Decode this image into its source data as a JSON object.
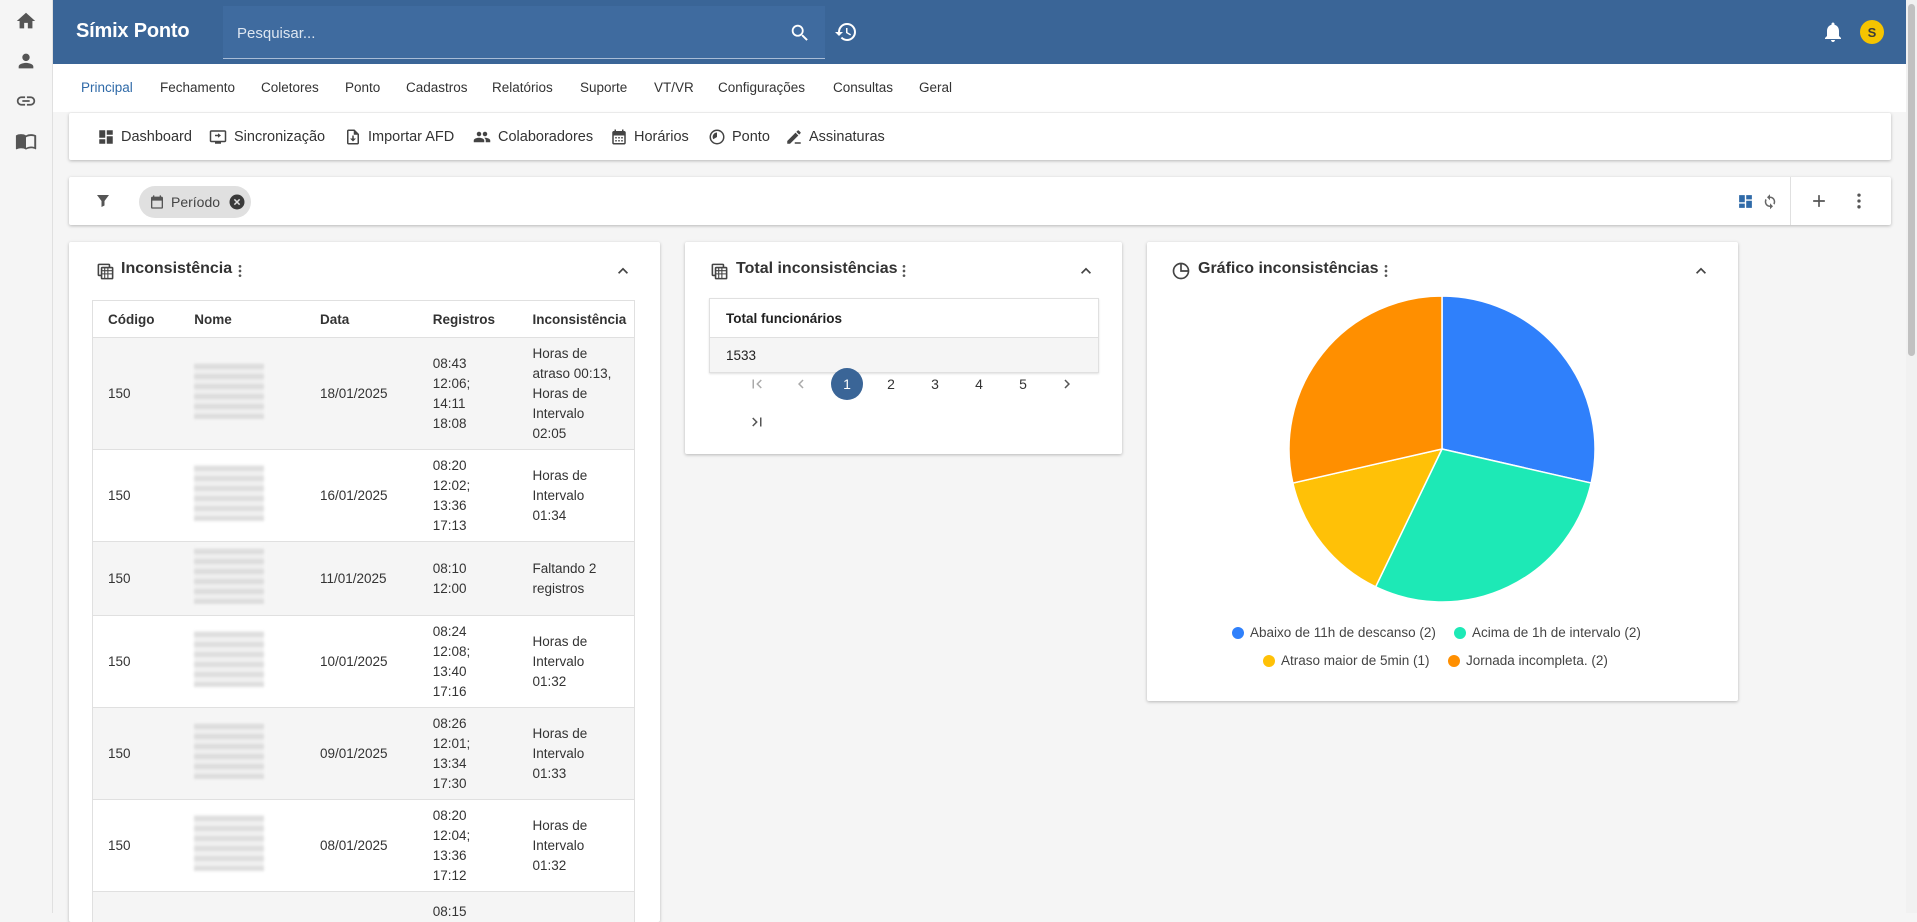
{
  "app": {
    "title": "Símix Ponto",
    "avatar_letter": "S"
  },
  "search": {
    "placeholder": "Pesquisar..."
  },
  "main_menu": [
    "Principal",
    "Fechamento",
    "Coletores",
    "Ponto",
    "Cadastros",
    "Relatórios",
    "Suporte",
    "VT/VR",
    "Configurações",
    "Consultas",
    "Geral"
  ],
  "sub_menu": [
    "Dashboard",
    "Sincronização",
    "Importar AFD",
    "Colaboradores",
    "Horários",
    "Ponto",
    "Assinaturas"
  ],
  "filter": {
    "chip_label": "Período"
  },
  "inconsistencia": {
    "title": "Inconsistência",
    "columns": [
      "Código",
      "Nome",
      "Data",
      "Registros",
      "Inconsistência"
    ],
    "rows": [
      {
        "codigo": "150",
        "data": "18/01/2025",
        "registros": [
          "08:43",
          "12:06;",
          "14:11",
          "18:08"
        ],
        "inconsistencia": [
          "Horas de",
          "atraso 00:13,",
          "Horas de",
          "Intervalo",
          "02:05"
        ]
      },
      {
        "codigo": "150",
        "data": "16/01/2025",
        "registros": [
          "08:20",
          "12:02;",
          "13:36",
          "17:13"
        ],
        "inconsistencia": [
          "Horas de",
          "Intervalo",
          "01:34"
        ]
      },
      {
        "codigo": "150",
        "data": "11/01/2025",
        "registros": [
          "08:10",
          "12:00"
        ],
        "inconsistencia": [
          "Faltando 2",
          "registros"
        ]
      },
      {
        "codigo": "150",
        "data": "10/01/2025",
        "registros": [
          "08:24",
          "12:08;",
          "13:40",
          "17:16"
        ],
        "inconsistencia": [
          "Horas de",
          "Intervalo",
          "01:32"
        ]
      },
      {
        "codigo": "150",
        "data": "09/01/2025",
        "registros": [
          "08:26",
          "12:01;",
          "13:34",
          "17:30"
        ],
        "inconsistencia": [
          "Horas de",
          "Intervalo",
          "01:33"
        ]
      },
      {
        "codigo": "150",
        "data": "08/01/2025",
        "registros": [
          "08:20",
          "12:04;",
          "13:36",
          "17:12"
        ],
        "inconsistencia": [
          "Horas de",
          "Intervalo",
          "01:32"
        ]
      },
      {
        "codigo": "",
        "data": "",
        "registros": [
          "08:15"
        ],
        "inconsistencia": []
      }
    ]
  },
  "total": {
    "title": "Total inconsistências",
    "column": "Total funcionários",
    "value": "1533",
    "pages": [
      "1",
      "2",
      "3",
      "4",
      "5"
    ],
    "current_page": "1"
  },
  "grafico": {
    "title": "Gráfico inconsistências"
  },
  "chart_data": {
    "type": "pie",
    "title": "Gráfico inconsistências",
    "series": [
      {
        "name": "Abaixo de 11h de descanso (2)",
        "value": 2,
        "color": "#2f80fb"
      },
      {
        "name": "Acima de 1h de intervalo (2)",
        "value": 2,
        "color": "#1de9b6"
      },
      {
        "name": "Atraso maior de 5min (1)",
        "value": 1,
        "color": "#ffc107"
      },
      {
        "name": "Jornada incompleta. (2)",
        "value": 2,
        "color": "#ff8f00"
      }
    ],
    "legend": "bottom"
  },
  "colors": {
    "primary": "#3a6597",
    "active_menu": "#2f6aa8"
  },
  "icons": {
    "rail": [
      "home-icon",
      "person-icon",
      "link-icon",
      "book-icon"
    ],
    "sub_menu": [
      "dashboard-icon",
      "sync-screen-icon",
      "import-file-icon",
      "people-icon",
      "calendar-icon",
      "clock-pie-icon",
      "signature-icon"
    ]
  }
}
